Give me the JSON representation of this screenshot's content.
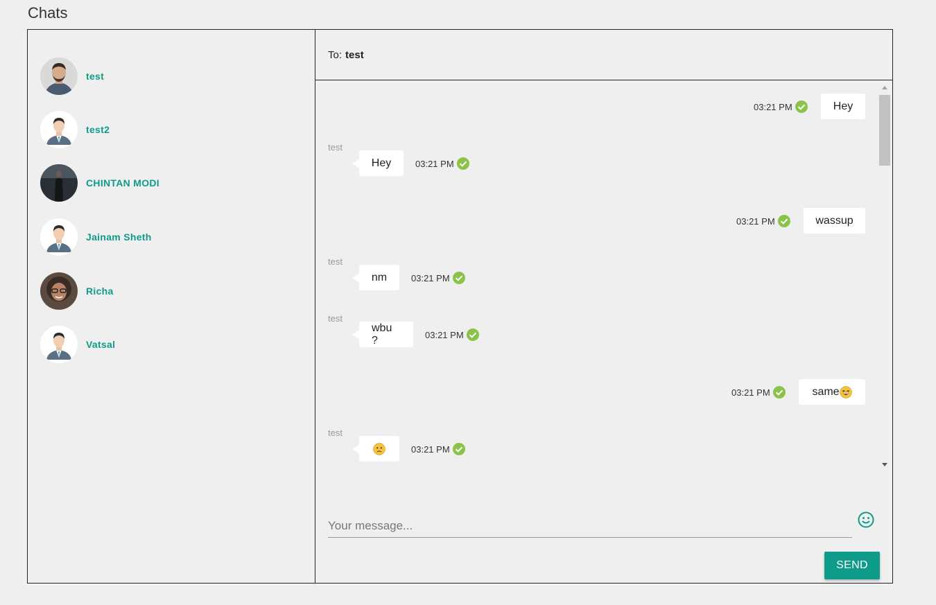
{
  "page": {
    "title": "Chats"
  },
  "contacts": [
    {
      "name": "test",
      "avatar": "photo-man-beard"
    },
    {
      "name": "test2",
      "avatar": "default-user-illustration"
    },
    {
      "name": "CHINTAN MODI",
      "avatar": "photo-dark-figure"
    },
    {
      "name": "Jainam Sheth",
      "avatar": "default-user-illustration"
    },
    {
      "name": "Richa",
      "avatar": "photo-woman-glasses"
    },
    {
      "name": "Vatsal",
      "avatar": "default-user-illustration"
    }
  ],
  "conversation": {
    "to_label": "To:",
    "to_name": "test",
    "messages": [
      {
        "direction": "out",
        "text": "Hey",
        "time": "03:21 PM",
        "status": "delivered"
      },
      {
        "direction": "in",
        "sender": "test",
        "text": "Hey",
        "time": "03:21 PM",
        "status": "delivered"
      },
      {
        "direction": "out",
        "text": "wassup",
        "time": "03:21 PM",
        "status": "delivered"
      },
      {
        "direction": "in",
        "sender": "test",
        "text": "nm",
        "time": "03:21 PM",
        "status": "delivered"
      },
      {
        "direction": "in",
        "sender": "test",
        "text": "wbu ?",
        "time": "03:21 PM",
        "status": "delivered"
      },
      {
        "direction": "out",
        "text": "same",
        "emoji": "laughing-face",
        "time": "03:21 PM",
        "status": "delivered"
      },
      {
        "direction": "in",
        "sender": "test",
        "text": "",
        "emoji": "confused-face",
        "time": "03:21 PM",
        "status": "delivered"
      }
    ]
  },
  "composer": {
    "placeholder": "Your message...",
    "value": "",
    "emoji_icon": "smiley-icon",
    "send_label": "SEND"
  },
  "colors": {
    "accent": "#0f9b8a",
    "check": "#8bc34a",
    "background": "#efefef",
    "bubble": "#ffffff"
  }
}
